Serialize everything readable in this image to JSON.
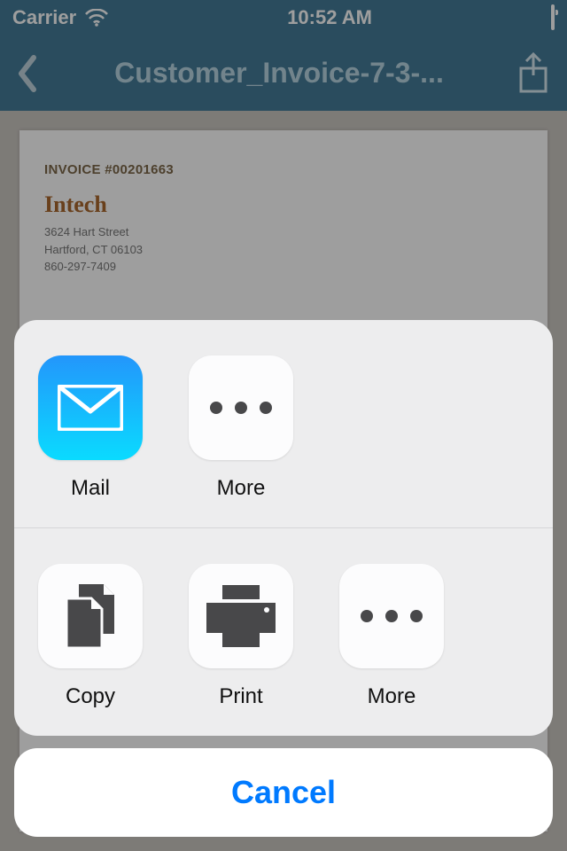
{
  "status": {
    "carrier": "Carrier",
    "time": "10:52 AM"
  },
  "nav": {
    "title": "Customer_Invoice-7-3-..."
  },
  "document": {
    "invoice_num": "INVOICE #00201663",
    "brand": "Intech",
    "address1": "3624 Hart Street",
    "address2": "Hartford, CT 06103",
    "phone": "860-297-7409"
  },
  "share_sheet": {
    "row1": [
      {
        "label": "Mail"
      },
      {
        "label": "More"
      }
    ],
    "row2": [
      {
        "label": "Copy"
      },
      {
        "label": "Print"
      },
      {
        "label": "More"
      }
    ],
    "cancel": "Cancel"
  }
}
